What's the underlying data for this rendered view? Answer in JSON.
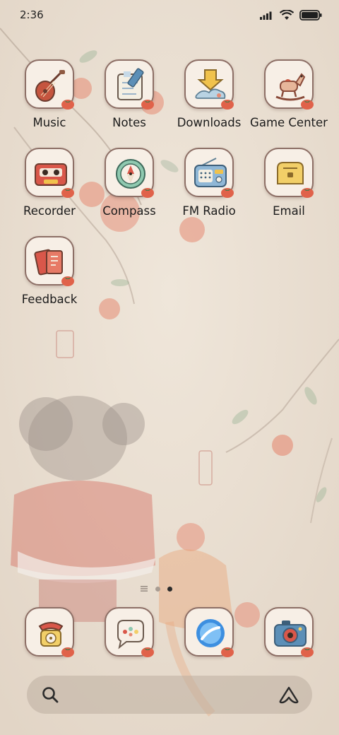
{
  "status_bar": {
    "time": "2:36",
    "battery_level": 1.0
  },
  "apps": [
    {
      "label": "Music",
      "icon": "pipa-icon"
    },
    {
      "label": "Notes",
      "icon": "notepad-icon"
    },
    {
      "label": "Downloads",
      "icon": "download-arrow-icon"
    },
    {
      "label": "Game Center",
      "icon": "rocking-horse-icon"
    },
    {
      "label": "Recorder",
      "icon": "cassette-icon"
    },
    {
      "label": "Compass",
      "icon": "compass-icon"
    },
    {
      "label": "FM Radio",
      "icon": "radio-icon"
    },
    {
      "label": "Email",
      "icon": "mailbox-icon"
    },
    {
      "label": "Feedback",
      "icon": "feedback-book-icon"
    }
  ],
  "page_indicator": {
    "pages": 2,
    "active": 2,
    "has_list_page": true
  },
  "dock": [
    {
      "icon": "phone-icon"
    },
    {
      "icon": "messages-icon"
    },
    {
      "icon": "browser-icon"
    },
    {
      "icon": "camera-icon"
    }
  ],
  "colors": {
    "wallpaper": "#e9ddd0",
    "persimmon": "#e0624a",
    "tile_border": "#8d6f66",
    "tile_fill": "#f7efe6"
  }
}
